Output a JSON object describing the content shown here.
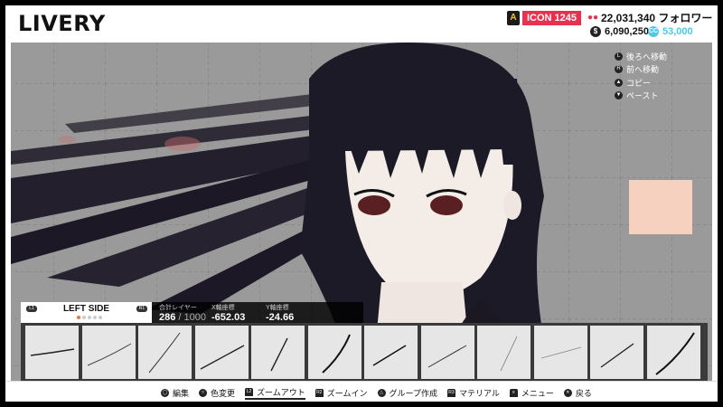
{
  "header": {
    "title": "LIVERY",
    "rank_label": "ICON 1245",
    "followers": "22,031,340 フォロワー",
    "coins": "6,090,250",
    "credits": "53,000",
    "icons": [
      "rank-icon",
      "follower-icon",
      "coin-icon",
      "credit-icon"
    ],
    "colors": {
      "accent": "#e8304f",
      "credit": "#4cc9e8",
      "selection": "#e07a3a"
    }
  },
  "context_menu": [
    {
      "label": "後ろへ移動",
      "icon": "button-icon"
    },
    {
      "label": "前へ移動",
      "icon": "button-icon"
    },
    {
      "label": "コピー",
      "icon": "button-icon"
    },
    {
      "label": "ペースト",
      "icon": "button-icon"
    }
  ],
  "swatch": {
    "color": "#f7d1c0"
  },
  "side_panel": {
    "label": "LEFT SIDE",
    "dots_total": 5,
    "dot_active": 0
  },
  "stats": {
    "layers_label": "合計レイヤー",
    "layers_value": "286",
    "layers_max": "/ 1000",
    "x_label": "X軸座標",
    "x_value": "-652.03",
    "y_label": "Y軸座標",
    "y_value": "-24.66"
  },
  "thumbnails": {
    "count": 12,
    "selected_index": 6
  },
  "bottom_bar": [
    {
      "label": "編集",
      "icon": "round-button-icon"
    },
    {
      "label": "色変更",
      "icon": "round-button-icon"
    },
    {
      "label": "ズームアウト",
      "icon": "shoulder-button-icon",
      "active": true
    },
    {
      "label": "ズームイン",
      "icon": "shoulder-button-icon"
    },
    {
      "label": "グループ作成",
      "icon": "round-button-icon"
    },
    {
      "label": "マテリアル",
      "icon": "shoulder-button-icon"
    },
    {
      "label": "メニュー",
      "icon": "options-button-icon"
    },
    {
      "label": "戻る",
      "icon": "round-button-icon"
    }
  ]
}
